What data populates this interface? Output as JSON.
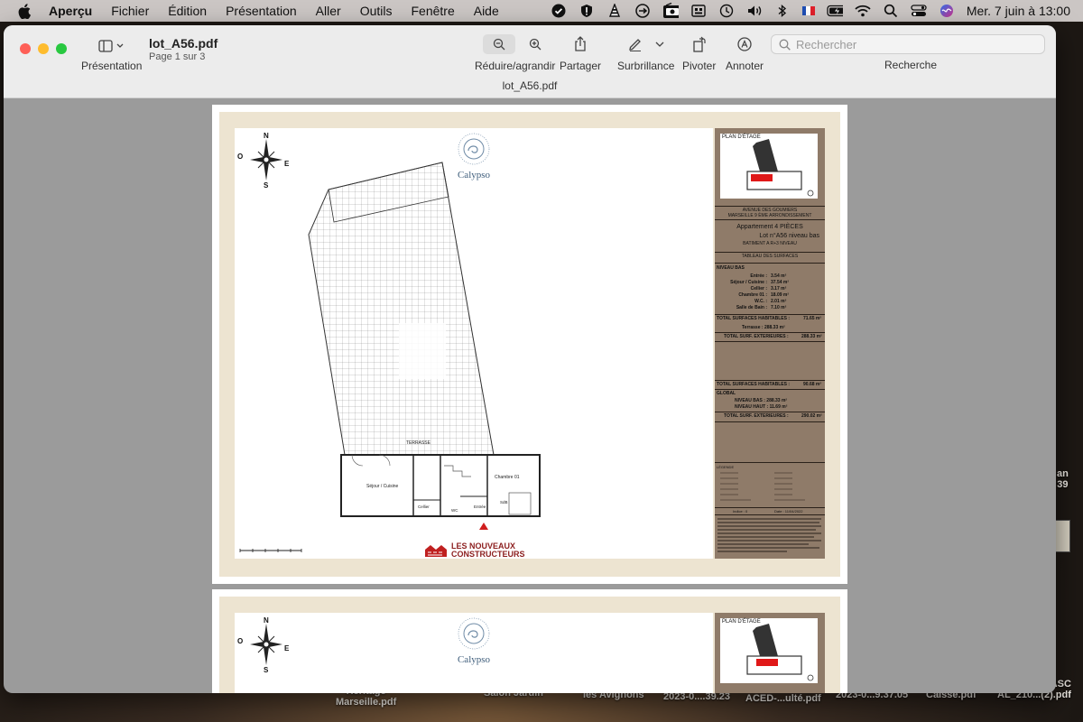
{
  "menubar": {
    "app_name": "Aperçu",
    "items": [
      "Fichier",
      "Édition",
      "Présentation",
      "Aller",
      "Outils",
      "Fenêtre",
      "Aide"
    ],
    "datetime": "Mer. 7 juin à 13:00"
  },
  "window": {
    "file_name": "lot_A56.pdf",
    "page_info": "Page 1 sur 3",
    "doc_title": "lot_A56.pdf",
    "toolbar": {
      "presentation_label": "Présentation",
      "zoom_label": "Réduire/agrandir",
      "share_label": "Partager",
      "highlight_label": "Surbrillance",
      "rotate_label": "Pivoter",
      "annotate_label": "Annoter",
      "search_placeholder": "Rechercher",
      "search_label": "Recherche"
    }
  },
  "document": {
    "page1": {
      "brand": "Calypso",
      "compass": {
        "n": "N",
        "s": "S",
        "e": "E",
        "o": "O"
      },
      "plan_labels": {
        "terrace": "TERRASSE",
        "living": "Séjour / Cuisine",
        "bedroom": "Chambre 01",
        "cellar": "Cellier",
        "entry": "Entrée",
        "bath": "SdB",
        "wc": "WC"
      },
      "builder_line1": "LES NOUVEAUX",
      "builder_line2": "CONSTRUCTEURS",
      "panel": {
        "plan_title": "PLAN D'ÉTAGE",
        "address1": "AVENUE DES GOUMIERS",
        "address2": "MARSEILLE 9 ÈME ARRONDISSEMENT",
        "apartment": "Appartement  4  PIÈCES",
        "lot": "Lot n°A56 niveau bas",
        "building": "BATIMENT  A    R+3 NIVEAU",
        "table_title": "TABLEAU DES SURFACES",
        "level_low": "NIVEAU BAS",
        "rows": [
          {
            "label": "Entrée :",
            "value": "3.54 m²"
          },
          {
            "label": "Séjour / Cuisine :",
            "value": "37.54 m²"
          },
          {
            "label": "Cellier :",
            "value": "3.17 m²"
          },
          {
            "label": "Chambre 01 :",
            "value": "18.09 m²"
          },
          {
            "label": "W.C. :",
            "value": "2.01 m²"
          },
          {
            "label": "Salle de Bain :",
            "value": "7.10 m²"
          }
        ],
        "total_hab_label": "TOTAL SURFACES HABITABLES :",
        "total_hab_value": "71.65 m²",
        "terrace_label": "Terrasse :",
        "terrace_value": "288.33 m²",
        "total_ext_label": "TOTAL SURF. EXTERIEURES :",
        "total_ext_value": "288.33 m²",
        "total_hab2_label": "TOTAL SURFACES HABITABLES :",
        "total_hab2_value": "90.68 m²",
        "global_label": "GLOBAL",
        "global_low_label": "NIVEAU BAS :",
        "global_low_value": "288.33 m²",
        "global_high_label": "NIVEAU HAUT :",
        "global_high_value": "11.69 m²",
        "total_ext2_label": "TOTAL SURF. EXTERIEURES :",
        "total_ext2_value": "290.02 m²",
        "legend_title": "LÉGENDE",
        "index_label": "Indice : 0",
        "date_label": "Date : 11/04/2022"
      }
    },
    "page2": {
      "brand": "Calypso",
      "compass": {
        "n": "N",
        "s": "S",
        "e": "E",
        "o": "O"
      },
      "plan_title": "PLAN D'ÉTAGE"
    }
  },
  "desktop": {
    "files": [
      {
        "line1": "Heritage",
        "line2": "Marseille.pdf"
      },
      {
        "line1": "Salon Jardin",
        "line2": ""
      },
      {
        "line1": "les Avignons",
        "line2": ""
      },
      {
        "line1": "2023-0....39.23",
        "line2": ""
      },
      {
        "line1": "ACED-...ulté.pdf",
        "line2": ""
      },
      {
        "line1": "2023-0...9.37.05",
        "line2": ""
      },
      {
        "line1": "Caisse.pdf",
        "line2": ""
      },
      {
        "line1": "ASC",
        "line2": "AL_210...(2).pdf"
      }
    ],
    "right_peek1": "an",
    "right_peek2": "39"
  },
  "colors": {
    "red_dot": "#fe5f57",
    "yellow_dot": "#febc2e",
    "green_dot": "#28c840",
    "panel_brown": "#8f7b69",
    "beige_border": "#ede4d1",
    "builder_red": "#8c1e1e"
  }
}
